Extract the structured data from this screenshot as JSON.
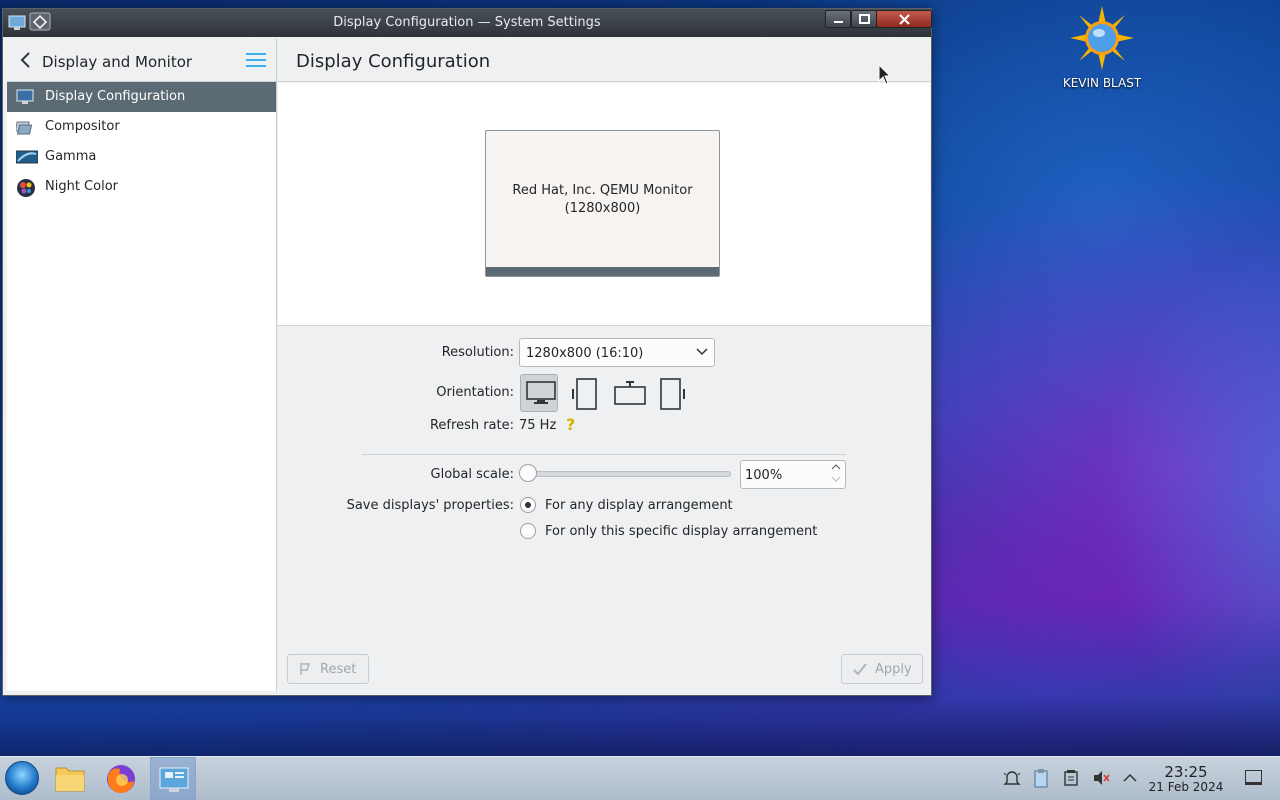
{
  "desktop": {
    "icon_label": "KEVIN BLAST"
  },
  "window": {
    "title": "Display Configuration — System Settings"
  },
  "sidebar": {
    "header_title": "Display and Monitor",
    "items": [
      {
        "label": "Display Configuration",
        "icon": "display-config-icon",
        "active": true
      },
      {
        "label": "Compositor",
        "icon": "compositor-icon",
        "active": false
      },
      {
        "label": "Gamma",
        "icon": "gamma-icon",
        "active": false
      },
      {
        "label": "Night Color",
        "icon": "night-color-icon",
        "active": false
      }
    ]
  },
  "main": {
    "page_title": "Display Configuration",
    "monitor_name": "Red Hat, Inc. QEMU Monitor",
    "monitor_resolution": "(1280x800)",
    "resolution_label": "Resolution:",
    "resolution_value": "1280x800 (16:10)",
    "orientation_label": "Orientation:",
    "orientations": [
      "landscape",
      "portrait-left",
      "landscape-flipped",
      "portrait-right"
    ],
    "orientation_selected": "landscape",
    "refresh_label": "Refresh rate:",
    "refresh_value": "75 Hz",
    "scale_label": "Global scale:",
    "scale_value": "100%",
    "save_label": "Save displays' properties:",
    "save_options": [
      {
        "label": "For any display arrangement",
        "checked": true
      },
      {
        "label": "For only this specific display arrangement",
        "checked": false
      }
    ],
    "reset_label": "Reset",
    "apply_label": "Apply"
  },
  "taskbar": {
    "time": "23:25",
    "date": "21 Feb 2024"
  },
  "colors": {
    "accent": "#3daee9",
    "selection": "#5c6b73",
    "hint": "#d8b300"
  }
}
